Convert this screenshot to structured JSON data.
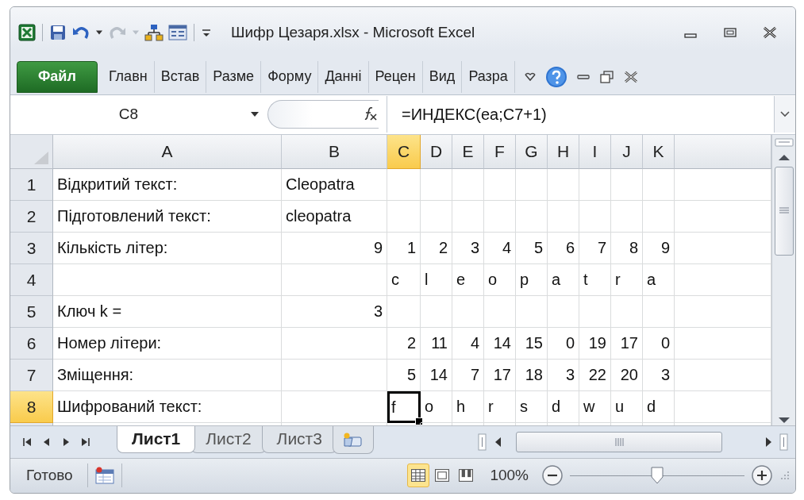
{
  "window": {
    "title": "Шифр Цезаря.xlsx  -  Microsoft Excel"
  },
  "ribbon_tabs": [
    {
      "label": "Файл",
      "kind": "file",
      "selected": false
    },
    {
      "label": "Главн",
      "kind": "tab",
      "selected": false
    },
    {
      "label": "Встав",
      "kind": "tab",
      "selected": false
    },
    {
      "label": "Разме",
      "kind": "tab",
      "selected": false
    },
    {
      "label": "Форму",
      "kind": "tab",
      "selected": false
    },
    {
      "label": "Данні",
      "kind": "tab",
      "selected": false
    },
    {
      "label": "Рецен",
      "kind": "tab",
      "selected": false
    },
    {
      "label": "Вид",
      "kind": "tab",
      "selected": false
    },
    {
      "label": "Разра",
      "kind": "tab",
      "selected": false
    }
  ],
  "formula_bar": {
    "name_box": "C8",
    "formula": "=ИНДЕКС(ea;C7+1)"
  },
  "columns": [
    {
      "label": "A",
      "selected": false
    },
    {
      "label": "B",
      "selected": false
    },
    {
      "label": "C",
      "selected": true
    },
    {
      "label": "D",
      "selected": false
    },
    {
      "label": "E",
      "selected": false
    },
    {
      "label": "F",
      "selected": false
    },
    {
      "label": "G",
      "selected": false
    },
    {
      "label": "H",
      "selected": false
    },
    {
      "label": "I",
      "selected": false
    },
    {
      "label": "J",
      "selected": false
    },
    {
      "label": "K",
      "selected": false
    }
  ],
  "rows": [
    {
      "header": "1",
      "selected": false,
      "cells": [
        {
          "text": "Відкритий текст:",
          "kind": "text"
        },
        {
          "text": "Cleopatra",
          "kind": "text"
        }
      ]
    },
    {
      "header": "2",
      "selected": false,
      "cells": [
        {
          "text": "Підготовлений текст:",
          "kind": "text"
        },
        {
          "text": "cleopatra",
          "kind": "text"
        }
      ]
    },
    {
      "header": "3",
      "selected": false,
      "cells": [
        {
          "text": "Кількість літер:",
          "kind": "text"
        },
        {
          "text": "9",
          "kind": "number"
        },
        {
          "text": "1",
          "kind": "number"
        },
        {
          "text": "2",
          "kind": "number"
        },
        {
          "text": "3",
          "kind": "number"
        },
        {
          "text": "4",
          "kind": "number"
        },
        {
          "text": "5",
          "kind": "number"
        },
        {
          "text": "6",
          "kind": "number"
        },
        {
          "text": "7",
          "kind": "number"
        },
        {
          "text": "8",
          "kind": "number"
        },
        {
          "text": "9",
          "kind": "number"
        }
      ]
    },
    {
      "header": "4",
      "selected": false,
      "cells": [
        null,
        null,
        {
          "text": "c",
          "kind": "text"
        },
        {
          "text": "l",
          "kind": "text"
        },
        {
          "text": "e",
          "kind": "text"
        },
        {
          "text": "o",
          "kind": "text"
        },
        {
          "text": "p",
          "kind": "text"
        },
        {
          "text": "a",
          "kind": "text"
        },
        {
          "text": "t",
          "kind": "text"
        },
        {
          "text": "r",
          "kind": "text"
        },
        {
          "text": "a",
          "kind": "text"
        }
      ]
    },
    {
      "header": "5",
      "selected": false,
      "cells": [
        {
          "text": "Ключ k =",
          "kind": "text"
        },
        {
          "text": "3",
          "kind": "number"
        }
      ]
    },
    {
      "header": "6",
      "selected": false,
      "cells": [
        {
          "text": "Номер літери:",
          "kind": "text"
        },
        null,
        {
          "text": "2",
          "kind": "number"
        },
        {
          "text": "11",
          "kind": "number"
        },
        {
          "text": "4",
          "kind": "number"
        },
        {
          "text": "14",
          "kind": "number"
        },
        {
          "text": "15",
          "kind": "number"
        },
        {
          "text": "0",
          "kind": "number"
        },
        {
          "text": "19",
          "kind": "number"
        },
        {
          "text": "17",
          "kind": "number"
        },
        {
          "text": "0",
          "kind": "number"
        }
      ]
    },
    {
      "header": "7",
      "selected": false,
      "cells": [
        {
          "text": "Зміщення:",
          "kind": "text"
        },
        null,
        {
          "text": "5",
          "kind": "number"
        },
        {
          "text": "14",
          "kind": "number"
        },
        {
          "text": "7",
          "kind": "number"
        },
        {
          "text": "17",
          "kind": "number"
        },
        {
          "text": "18",
          "kind": "number"
        },
        {
          "text": "3",
          "kind": "number"
        },
        {
          "text": "22",
          "kind": "number"
        },
        {
          "text": "20",
          "kind": "number"
        },
        {
          "text": "3",
          "kind": "number"
        }
      ]
    },
    {
      "header": "8",
      "selected": true,
      "cells": [
        {
          "text": "Шифрований текст:",
          "kind": "text"
        },
        null,
        {
          "text": "f",
          "kind": "text"
        },
        {
          "text": "o",
          "kind": "text"
        },
        {
          "text": "h",
          "kind": "text"
        },
        {
          "text": "r",
          "kind": "text"
        },
        {
          "text": "s",
          "kind": "text"
        },
        {
          "text": "d",
          "kind": "text"
        },
        {
          "text": "w",
          "kind": "text"
        },
        {
          "text": "u",
          "kind": "text"
        },
        {
          "text": "d",
          "kind": "text"
        }
      ]
    }
  ],
  "sheet_tabs": [
    {
      "label": "Лист1",
      "selected": true
    },
    {
      "label": "Лист2",
      "selected": false
    },
    {
      "label": "Лист3",
      "selected": false
    }
  ],
  "status_bar": {
    "status": "Готово",
    "views": [
      {
        "kind": "normal",
        "selected": true
      },
      {
        "kind": "layout",
        "selected": false
      },
      {
        "kind": "pagebreak",
        "selected": false
      }
    ],
    "zoom": "100%",
    "zoom_slider": {
      "level": 0.5
    }
  }
}
